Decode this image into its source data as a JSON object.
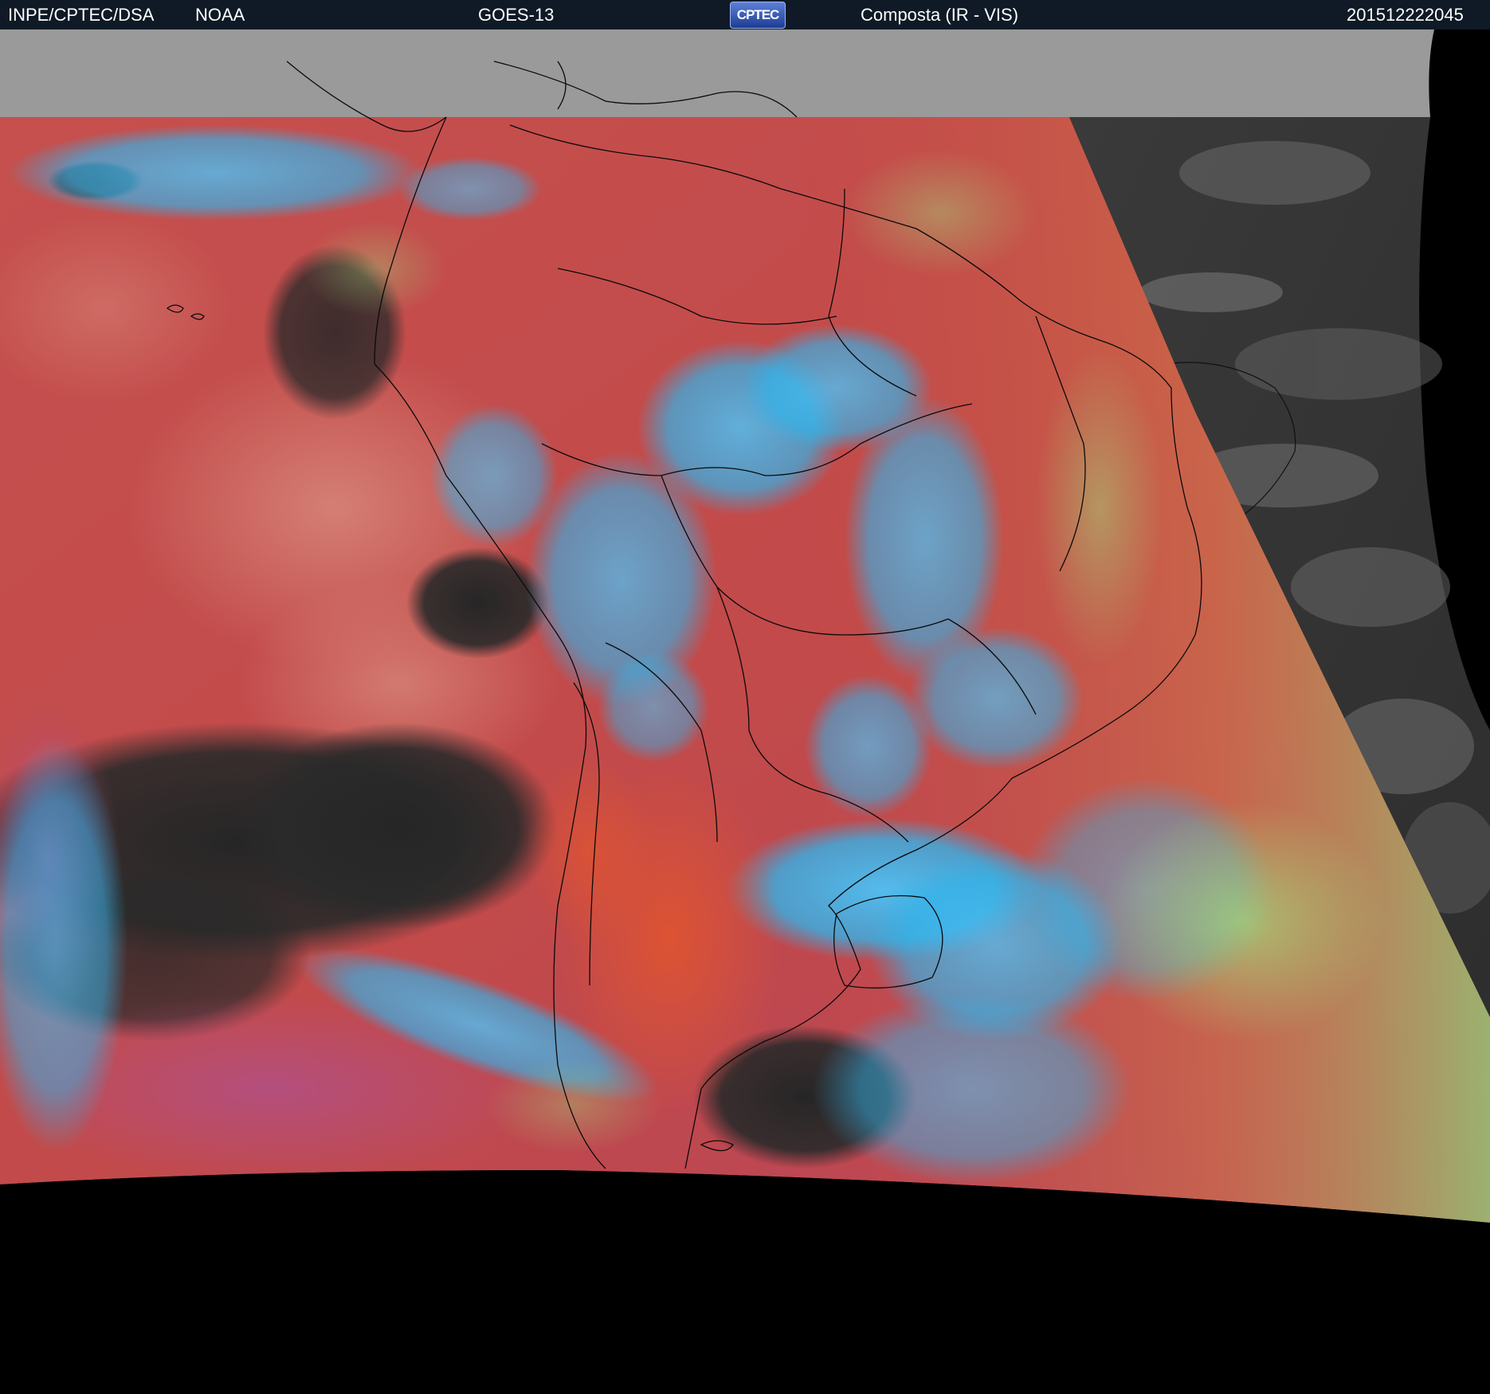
{
  "header": {
    "org": "INPE/CPTEC/DSA",
    "agency": "NOAA",
    "satellite": "GOES-13",
    "logo_text": "CPTEC",
    "product": "Composta (IR - VIS)",
    "timestamp": "201512222045"
  },
  "colors": {
    "header_bg": "#0f1a26",
    "header_text": "#ffffff",
    "no_data": "#000000",
    "off_coverage": "#9a9a9a",
    "surface_red": "#c0464a",
    "cloud_cyan": "#2fbef2",
    "cloud_green": "#8ee07a",
    "cold_cloud_dark": "#2a2a2a",
    "visible_gray": "#3c3c3c",
    "coastline": "#000000"
  },
  "icons": [
    "cptec-logo-icon"
  ]
}
